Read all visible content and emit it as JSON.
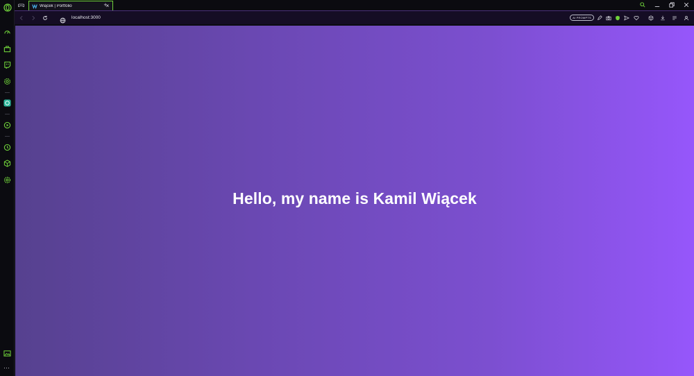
{
  "browser": {
    "tab": {
      "title": "Wiącek | Portfolio"
    },
    "new_tab_symbol": "+",
    "close_symbol": "×",
    "url": "localhost:3000",
    "ai_badge": "AI PROMPTS",
    "more_symbol": "···"
  },
  "page": {
    "heading": "Hello, my name is Kamil Wiącek"
  },
  "colors": {
    "accent_green": "#6fd13a",
    "gradient_start": "#56418f",
    "gradient_end": "#9656fb"
  },
  "icons": {
    "sidebar": [
      "speed-dial-icon",
      "briefcase-icon",
      "twitch-icon",
      "settings-gear-icon",
      "chatgpt-icon",
      "player-icon",
      "history-icon",
      "cube-icon",
      "gear-icon",
      "gallery-icon"
    ],
    "toolbar": [
      "pencil-icon",
      "camera-icon",
      "shield-icon",
      "send-icon",
      "heart-icon",
      "extensions-icon",
      "download-icon",
      "menu-icon",
      "profile-icon"
    ]
  }
}
